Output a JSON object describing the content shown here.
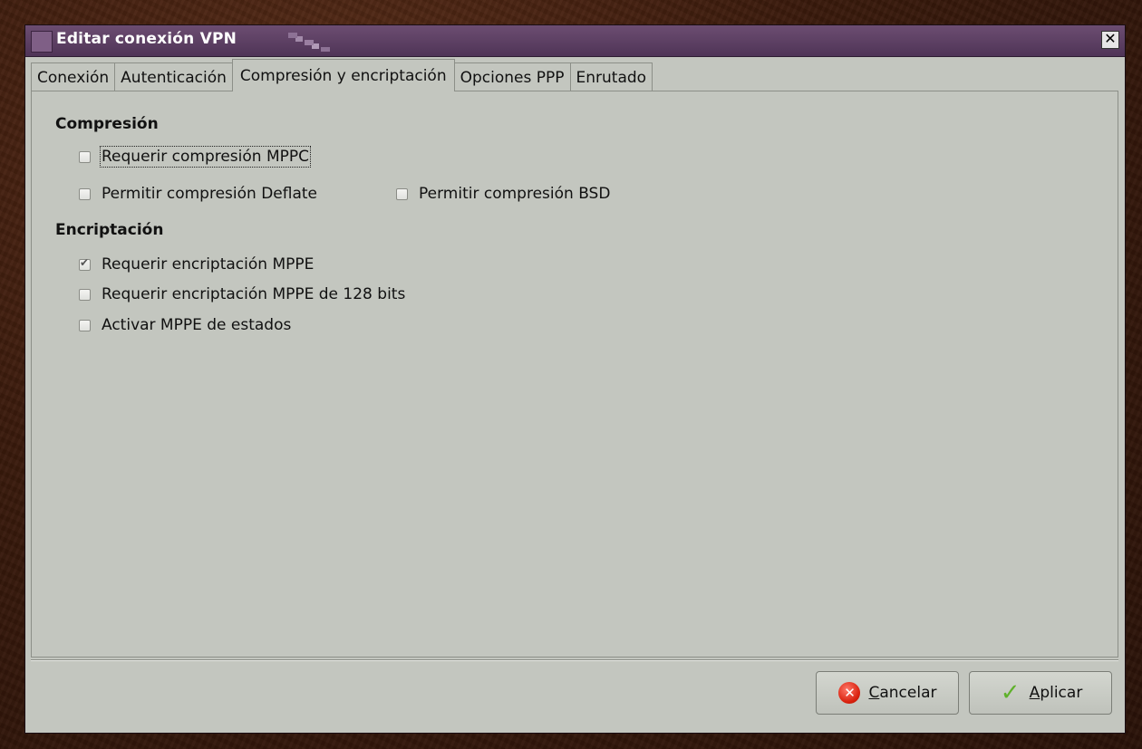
{
  "window": {
    "title": "Editar conexión VPN",
    "close_glyph": "✕"
  },
  "tabs": [
    {
      "label": "Conexión"
    },
    {
      "label": "Autenticación"
    },
    {
      "label": "Compresión y encriptación",
      "active": true
    },
    {
      "label": "Opciones PPP"
    },
    {
      "label": "Enrutado"
    }
  ],
  "compression": {
    "heading": "Compresión",
    "mppc": {
      "label": "Requerir compresión MPPC",
      "checked": false
    },
    "deflate": {
      "label": "Permitir compresión Deflate",
      "checked": false
    },
    "bsd": {
      "label": "Permitir compresión BSD",
      "checked": false
    }
  },
  "encryption": {
    "heading": "Encriptación",
    "mppe": {
      "label": "Requerir encriptación MPPE",
      "checked": true
    },
    "mppe128": {
      "label": "Requerir encriptación MPPE de 128 bits",
      "checked": false
    },
    "stateful": {
      "label": "Activar MPPE de estados",
      "checked": false
    }
  },
  "buttons": {
    "cancel_mnemonic": "C",
    "cancel_rest": "ancelar",
    "cancel_icon": "cancel-icon",
    "apply_mnemonic": "A",
    "apply_rest": "plicar",
    "apply_icon": "checkmark-icon"
  },
  "colors": {
    "titlebar": "#5c3f63",
    "dialog_bg": "#c3c6bf",
    "cancel_icon": "#d9210e",
    "apply_icon": "#5fb12b"
  }
}
